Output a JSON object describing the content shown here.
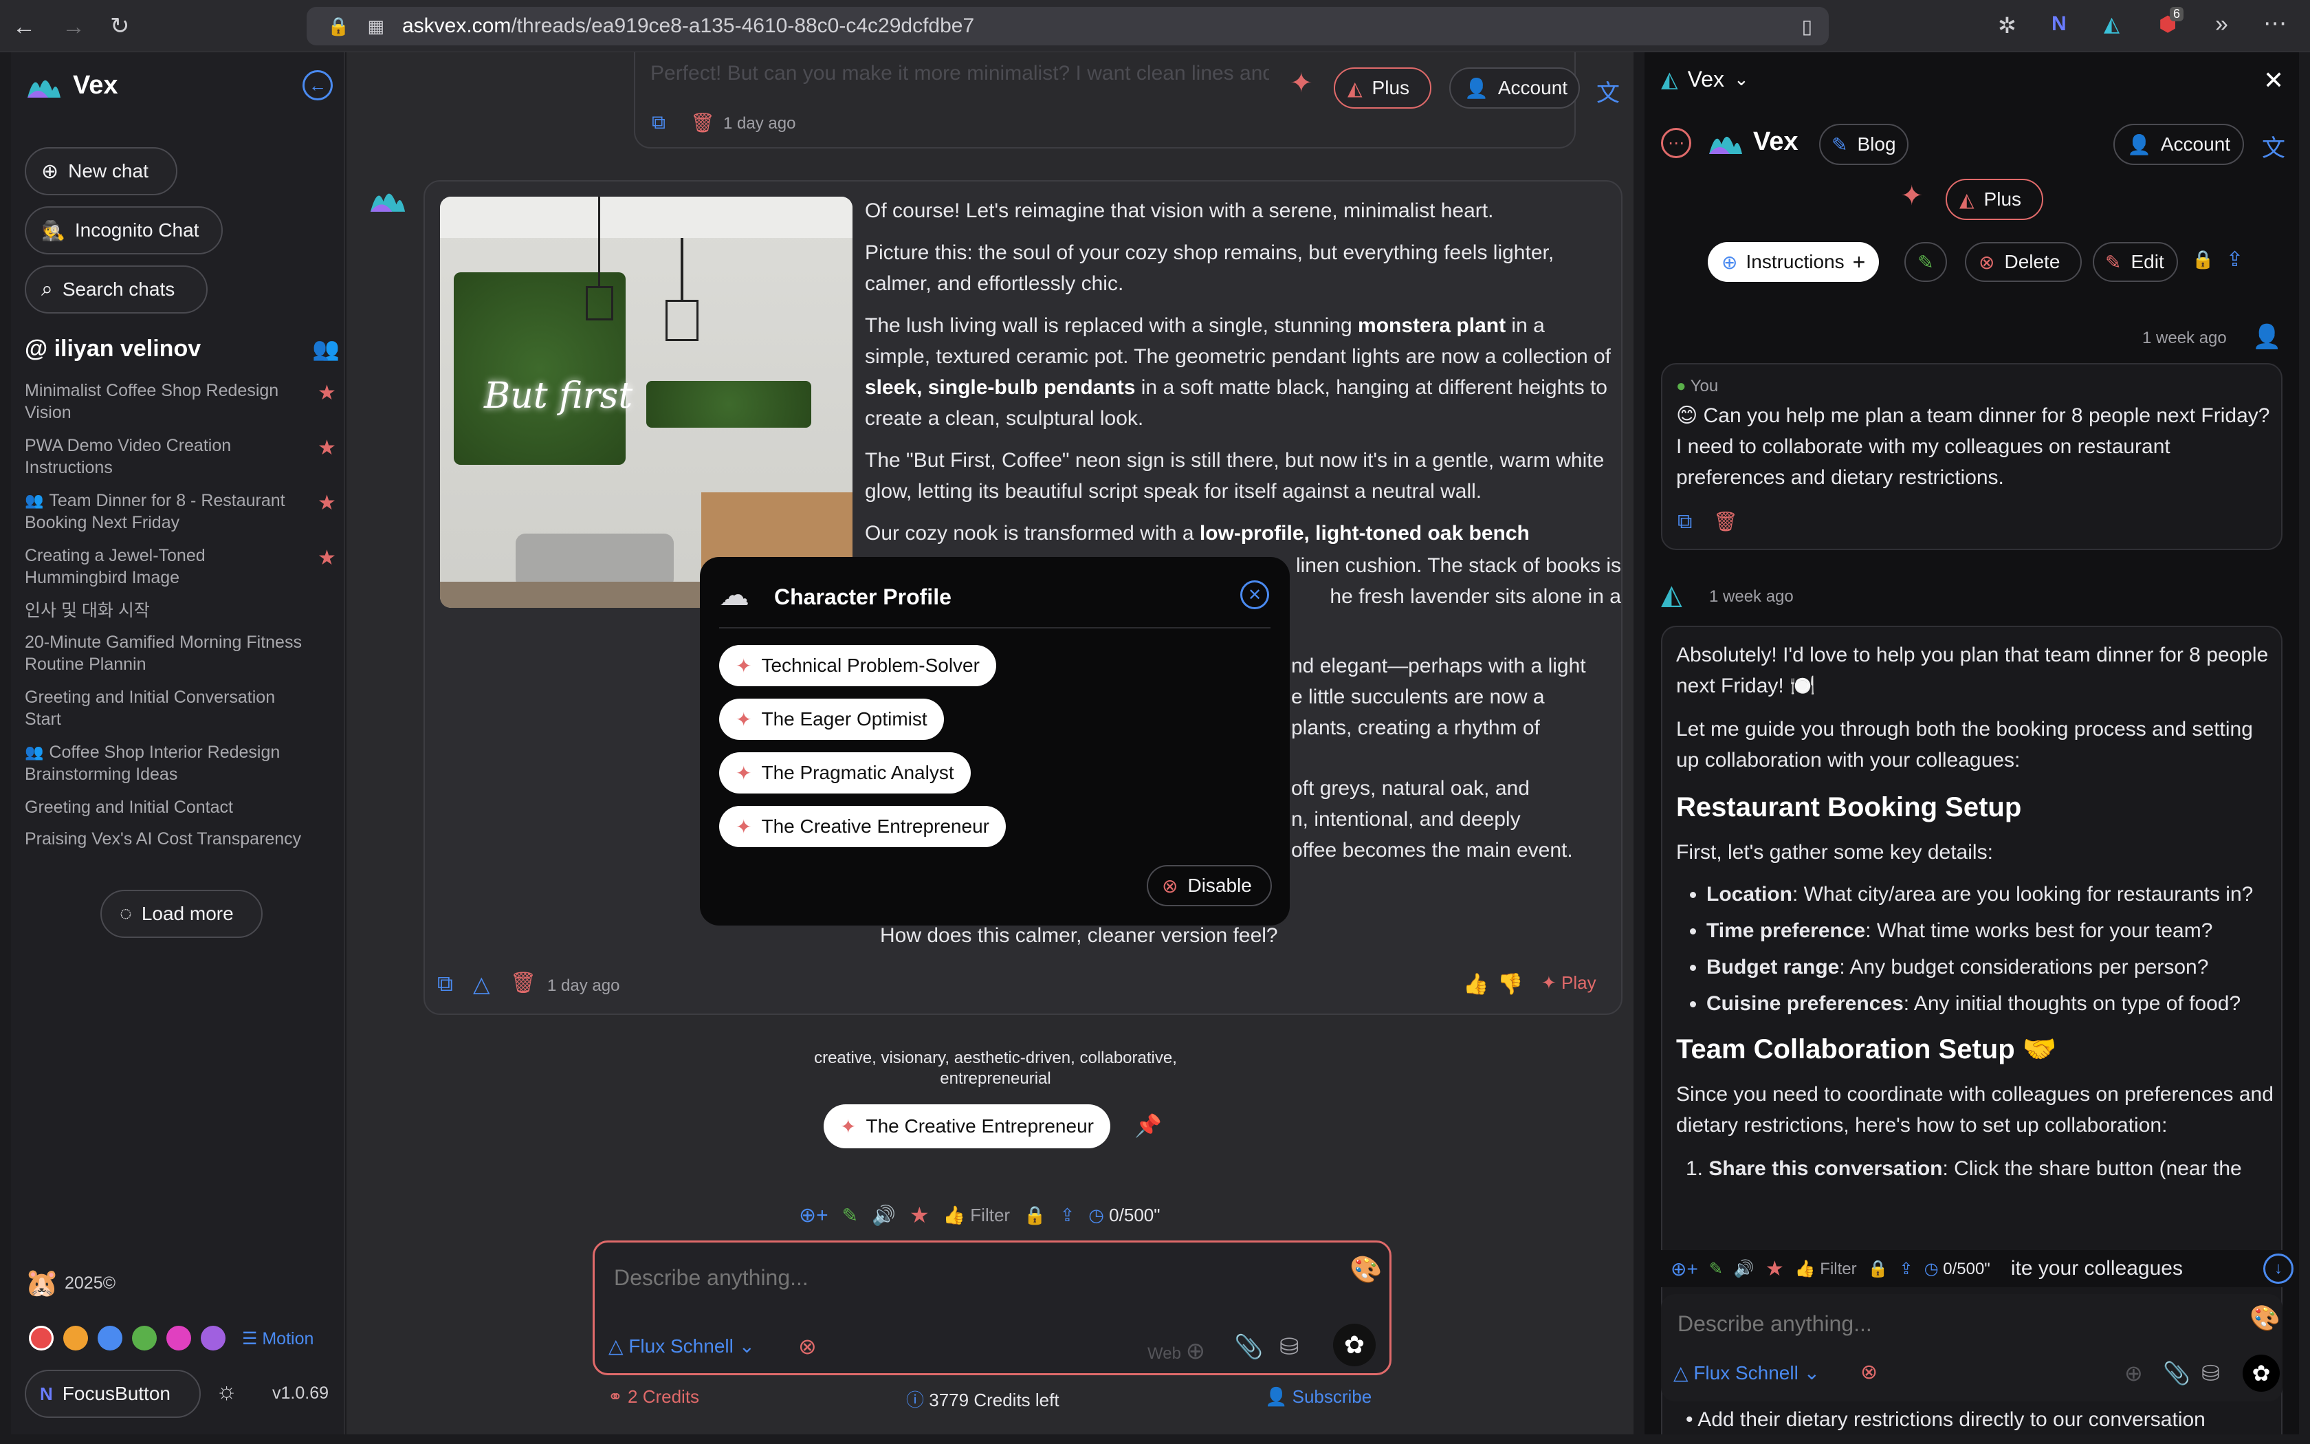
{
  "browser": {
    "url_domain": "askvex.com",
    "url_path": "/threads/ea919ce8-a135-4610-88c0-c4c29dcfdbe7",
    "ext_badge": "6"
  },
  "sidebar": {
    "app_name": "Vex",
    "new_chat": "New chat",
    "incognito": "Incognito Chat",
    "search": "Search chats",
    "user": "@ iliyan velinov",
    "threads": [
      {
        "title": "Minimalist Coffee Shop Redesign Vision",
        "starred": true,
        "shared": false
      },
      {
        "title": "PWA Demo Video Creation Instructions",
        "starred": true,
        "shared": false
      },
      {
        "title": "Team Dinner for 8 - Restaurant Booking Next Friday",
        "starred": true,
        "shared": true
      },
      {
        "title": "Creating a Jewel-Toned Hummingbird Image",
        "starred": true,
        "shared": false
      },
      {
        "title": "인사 및 대화 시작",
        "starred": false,
        "shared": false
      },
      {
        "title": "20-Minute Gamified Morning Fitness Routine Plannin",
        "starred": false,
        "shared": false
      },
      {
        "title": "Greeting and Initial Conversation Start",
        "starred": false,
        "shared": false
      },
      {
        "title": "Coffee Shop Interior Redesign Brainstorming Ideas",
        "starred": false,
        "shared": true
      },
      {
        "title": "Greeting and Initial Contact",
        "starred": false,
        "shared": false
      },
      {
        "title": "Praising Vex's AI Cost Transparency",
        "starred": false,
        "shared": false
      }
    ],
    "load_more": "Load more",
    "year": "2025©",
    "colors": [
      "#e84a4a",
      "#f0a030",
      "#4a8af0",
      "#5ab04a",
      "#e040c0",
      "#a060e0"
    ],
    "motion": "Motion",
    "focus_button": "FocusButton",
    "version": "v1.0.69"
  },
  "header": {
    "prev_text": "Perfect! But can you make it more minimalist? I want clean lines and",
    "prev_time": "1 day ago",
    "plus": "Plus",
    "account": "Account"
  },
  "message": {
    "image_sign": "But first",
    "paragraphs": [
      "Of course! Let's reimagine that vision with a serene, minimalist heart.",
      "Picture this: the soul of your cozy shop remains, but everything feels lighter, calmer, and effortlessly chic."
    ],
    "p3_a": "The lush living wall is replaced with a single, stunning ",
    "p3_b": "monstera plant",
    "p3_c": " in a simple, textured ceramic pot. The geometric pendant lights are now a collection of ",
    "p3_d": "sleek, single-bulb pendants",
    "p3_e": " in a soft matte black, hanging at different heights to create a clean, sculptural look.",
    "p4": "The \"But First, Coffee\" neon sign is still there, but now it's in a gentle, warm white glow, letting its beautiful script speak for itself against a neutral wall.",
    "p5_a": "Our cozy nook is transformed with a ",
    "p5_b": "low-profile, light-toned oak bench",
    "p5_tail": "linen cushion. The stack of books is",
    "p5_tail2": "he fresh lavender sits alone in a",
    "p6_tail": "nd elegant—perhaps with a light",
    "p6_tail2": "e little succulents are now a",
    "p6_tail3": "plants, creating a rhythm of",
    "p7_tail": "oft greys, natural oak, and",
    "p7_tail2": "n, intentional, and deeply",
    "p7_tail3": "offee becomes the main event.",
    "question": "How does this calmer, cleaner version feel?",
    "time": "1 day ago",
    "play": "Play"
  },
  "traits": {
    "text": "creative, visionary, aesthetic-driven, collaborative, entrepreneurial",
    "persona": "The Creative Entrepreneur"
  },
  "toolbar": {
    "filter": "Filter",
    "counter": "0/500\""
  },
  "composer": {
    "placeholder": "Describe anything...",
    "model": "Flux Schnell",
    "web": "Web",
    "credits": "2 Credits",
    "credits_left": "3779 Credits left",
    "subscribe": "Subscribe"
  },
  "popup": {
    "title": "Character Profile",
    "roles": [
      "Technical Problem-Solver",
      "The Eager Optimist",
      "The Pragmatic Analyst",
      "The Creative Entrepreneur"
    ],
    "disable": "Disable"
  },
  "right": {
    "tab": "Vex",
    "brand": "Vex",
    "blog": "Blog",
    "account": "Account",
    "plus": "Plus",
    "instructions": "Instructions",
    "delete": "Delete",
    "edit": "Edit",
    "time1": "1 week ago",
    "you": "You",
    "user_msg": "😊 Can you help me plan a team dinner for 8 people next Friday? I need to collaborate with my colleagues on restaurant preferences and dietary restrictions.",
    "time2": "1 week ago",
    "ai_intro": "Absolutely! I'd love to help you plan that team dinner for 8 people next Friday! 🍽️",
    "ai_guide": "Let me guide you through both the booking process and setting up collaboration with your colleagues:",
    "h1": "Restaurant Booking Setup",
    "gather": "First, let's gather some key details:",
    "bullets": [
      {
        "k": "Location",
        "v": ": What city/area are you looking for restaurants in?"
      },
      {
        "k": "Time preference",
        "v": ": What time works best for your team?"
      },
      {
        "k": "Budget range",
        "v": ": Any budget considerations per person?"
      },
      {
        "k": "Cuisine preferences",
        "v": ": Any initial thoughts on type of food?"
      }
    ],
    "h2": "Team Collaboration Setup 🤝",
    "collab": "Since you need to coordinate with colleagues on preferences and dietary restrictions, here's how to set up collaboration:",
    "step1_k": "Share this conversation",
    "step1_v": ": Click the share button (near the",
    "step1_tail": "ite your colleagues",
    "step3": "Add their dietary restrictions directly to our conversation",
    "filter": "Filter",
    "counter": "0/500\"",
    "placeholder": "Describe anything...",
    "model": "Flux Schnell"
  }
}
